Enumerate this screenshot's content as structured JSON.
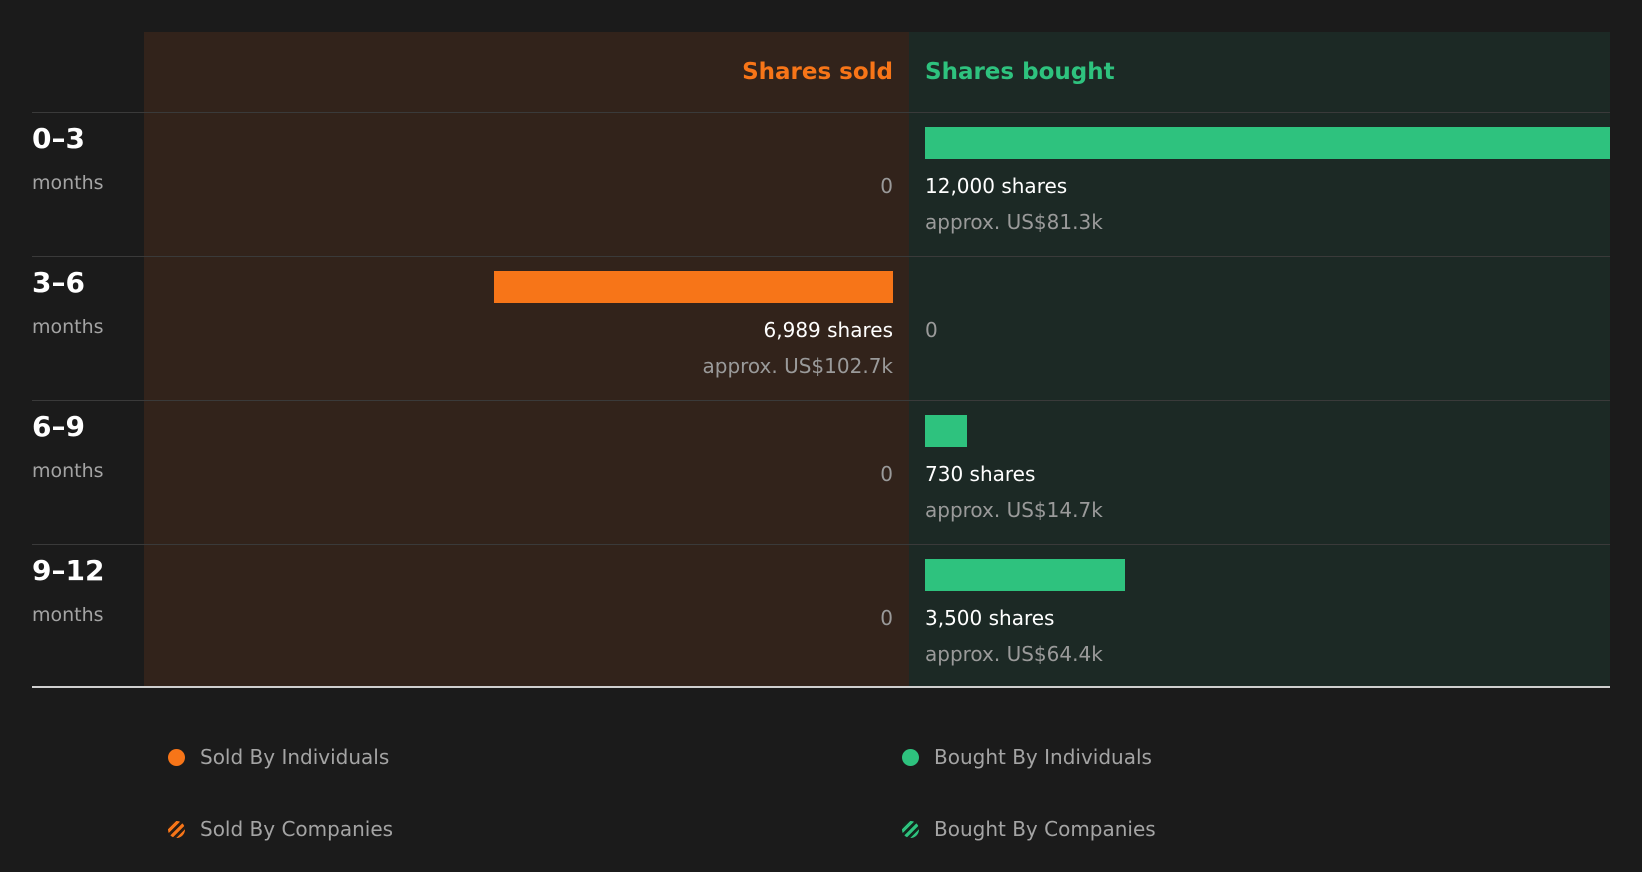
{
  "colors": {
    "sold": "#f77518",
    "bought": "#2ec27e",
    "sold_bg": "#32231b",
    "bought_bg": "#1c2925"
  },
  "chart_data": {
    "type": "bar",
    "headers": {
      "sold": "Shares sold",
      "bought": "Shares bought"
    },
    "categories": [
      {
        "label": "0–3",
        "sub": "months"
      },
      {
        "label": "3–6",
        "sub": "months"
      },
      {
        "label": "6–9",
        "sub": "months"
      },
      {
        "label": "9–12",
        "sub": "months"
      }
    ],
    "max_shares": 12000,
    "series": [
      {
        "name": "Shares sold",
        "values": [
          0,
          6989,
          0,
          0
        ],
        "shares_text": [
          "0",
          "6,989 shares",
          "0",
          "0"
        ],
        "approx_text": [
          "",
          "approx. US$102.7k",
          "",
          ""
        ]
      },
      {
        "name": "Shares bought",
        "values": [
          12000,
          0,
          730,
          3500
        ],
        "shares_text": [
          "12,000 shares",
          "0",
          "730 shares",
          "3,500 shares"
        ],
        "approx_text": [
          "approx. US$81.3k",
          "",
          "approx. US$14.7k",
          "approx. US$64.4k"
        ]
      }
    ],
    "legend": [
      {
        "label": "Sold By Individuals",
        "style": "solid",
        "color": "#f77518"
      },
      {
        "label": "Bought By Individuals",
        "style": "solid",
        "color": "#2ec27e"
      },
      {
        "label": "Sold By Companies",
        "style": "striped",
        "color": "#f77518"
      },
      {
        "label": "Bought By Companies",
        "style": "striped",
        "color": "#2ec27e"
      }
    ]
  }
}
